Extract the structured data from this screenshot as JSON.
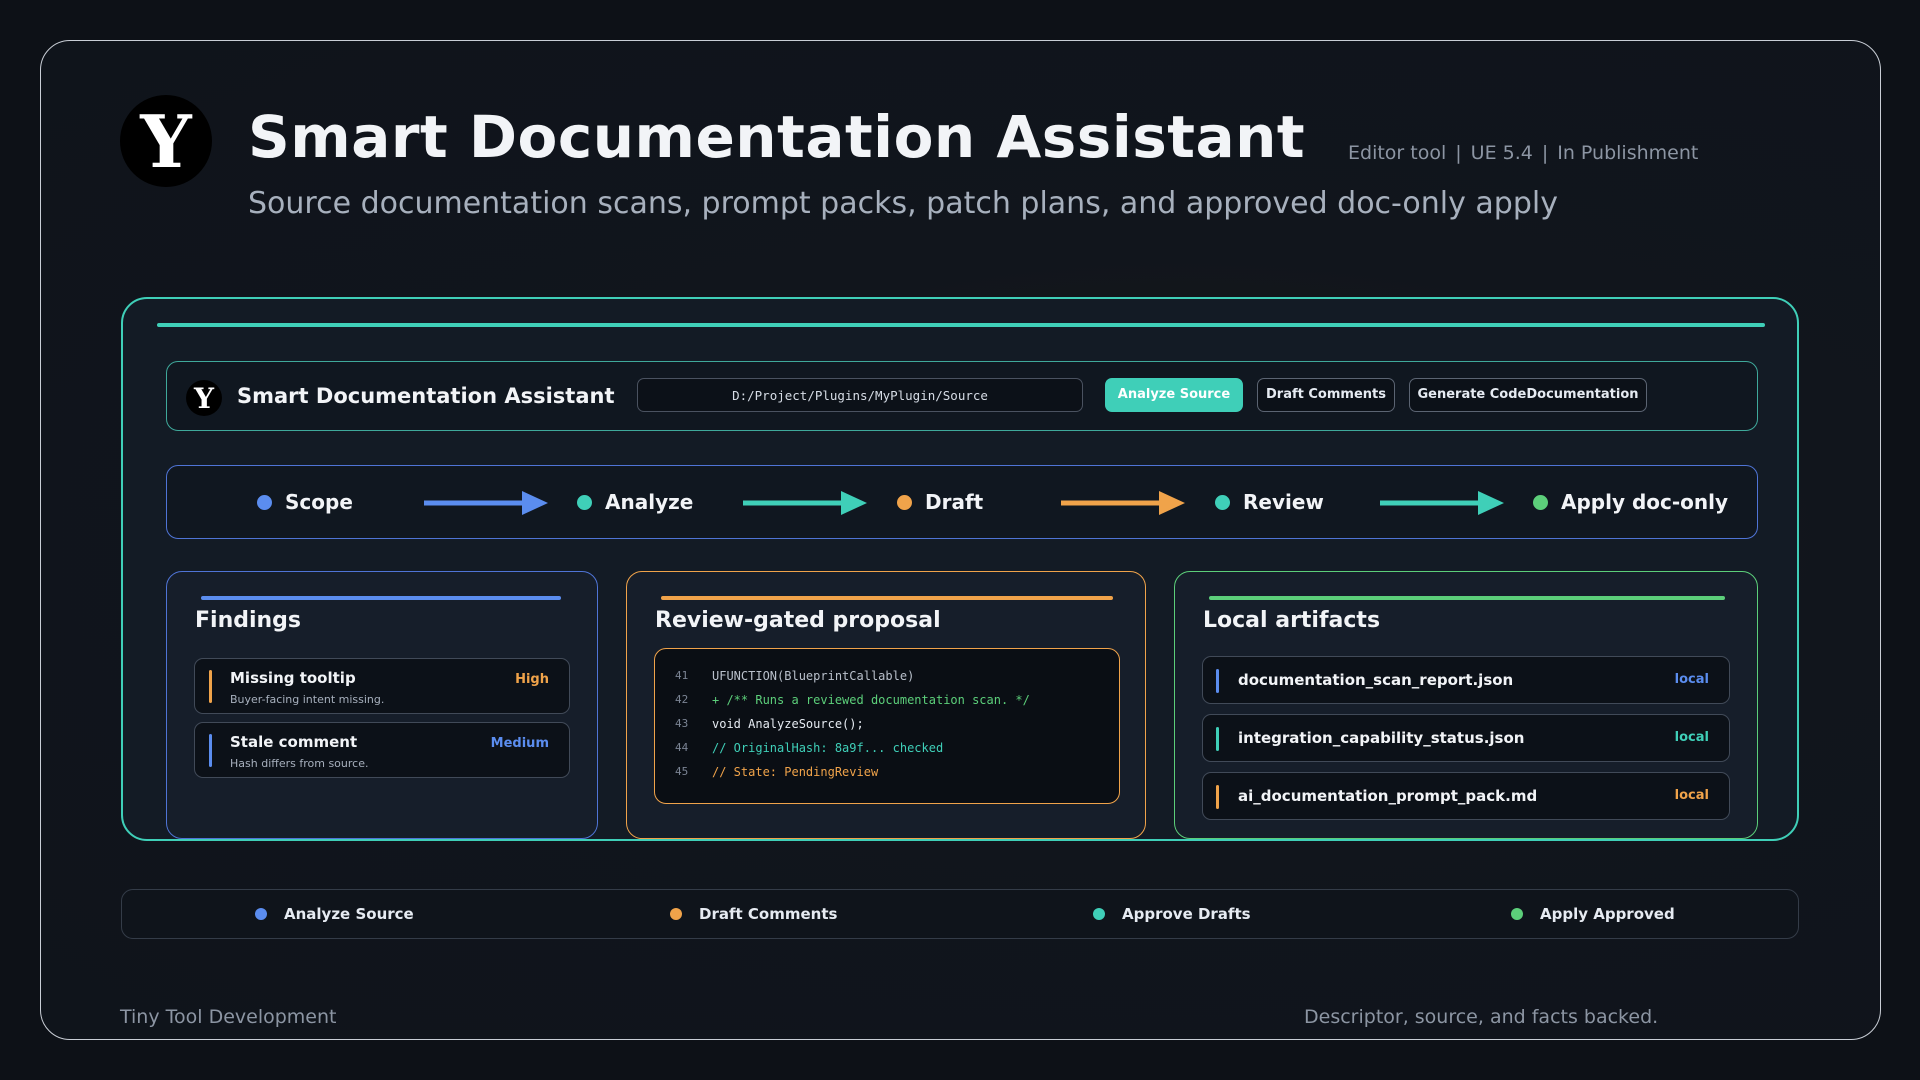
{
  "header": {
    "logo_letter": "Y",
    "title": "Smart Documentation Assistant",
    "subtitle": "Source documentation scans, prompt packs, patch plans, and approved doc-only apply",
    "meta": {
      "type": "Editor tool",
      "version": "UE 5.4",
      "status": "In Publishment",
      "separator": "|"
    }
  },
  "toolbar": {
    "logo_letter": "Y",
    "title": "Smart Documentation Assistant",
    "path_value": "D:/Project/Plugins/MyPlugin/Source",
    "analyze_label": "Analyze Source",
    "draft_label": "Draft Comments",
    "generate_label": "Generate CodeDocumentation"
  },
  "workflow": {
    "steps": [
      {
        "label": "Scope",
        "color": "#5b8def"
      },
      {
        "label": "Analyze",
        "color": "#3fcfb8"
      },
      {
        "label": "Draft",
        "color": "#f0a34a"
      },
      {
        "label": "Review",
        "color": "#3fcfb8"
      },
      {
        "label": "Apply doc-only",
        "color": "#5ccf7a"
      }
    ],
    "arrow_colors": [
      "#5b8def",
      "#3fcfb8",
      "#f0a34a",
      "#3fcfb8"
    ]
  },
  "findings": {
    "title": "Findings",
    "accent": "#5b8def",
    "items": [
      {
        "title": "Missing tooltip",
        "subtitle": "Buyer-facing intent missing.",
        "severity": "High",
        "color": "#f0a34a"
      },
      {
        "title": "Stale comment",
        "subtitle": "Hash differs from source.",
        "severity": "Medium",
        "color": "#5b8def"
      }
    ]
  },
  "review": {
    "title": "Review-gated proposal",
    "accent": "#f0a34a",
    "code_lines": [
      {
        "num": "41",
        "text": "UFUNCTION(BlueprintCallable)",
        "color": "#b9c0cb"
      },
      {
        "num": "42",
        "text": "+ /** Runs a reviewed documentation scan. */",
        "color": "#5ccf7a"
      },
      {
        "num": "43",
        "text": "void AnalyzeSource();",
        "color": "#e6ebf2"
      },
      {
        "num": "44",
        "text": "// OriginalHash: 8a9f... checked",
        "color": "#3fcfb8"
      },
      {
        "num": "45",
        "text": "// State: PendingReview",
        "color": "#f0a34a"
      }
    ]
  },
  "artifacts": {
    "title": "Local artifacts",
    "accent": "#5ccf7a",
    "items": [
      {
        "name": "documentation_scan_report.json",
        "tag": "local",
        "color": "#5b8def"
      },
      {
        "name": "integration_capability_status.json",
        "tag": "local",
        "color": "#3fcfb8"
      },
      {
        "name": "ai_documentation_prompt_pack.md",
        "tag": "local",
        "color": "#f0a34a"
      }
    ]
  },
  "legend": [
    {
      "label": "Analyze Source",
      "color": "#5b8def"
    },
    {
      "label": "Draft Comments",
      "color": "#f0a34a"
    },
    {
      "label": "Approve Drafts",
      "color": "#3fcfb8"
    },
    {
      "label": "Apply Approved",
      "color": "#5ccf7a"
    }
  ],
  "footer": {
    "left": "Tiny Tool Development",
    "right": "Descriptor, source, and facts backed."
  }
}
